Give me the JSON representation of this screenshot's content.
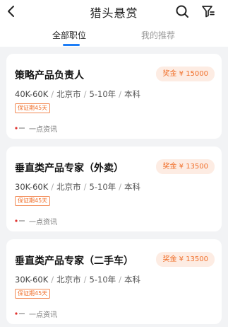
{
  "header": {
    "title": "猎头悬赏",
    "icons": {
      "back": "chevron-left-icon",
      "search": "search-icon",
      "filter": "filter-icon"
    }
  },
  "tabs": [
    {
      "label": "全部职位",
      "active": true
    },
    {
      "label": "我的推荐",
      "active": false
    }
  ],
  "jobs": [
    {
      "title": "策略产品负责人",
      "bonus": "奖金 ¥ 15000",
      "salary": "40K-60K",
      "city": "北京市",
      "experience": "5-10年",
      "education": "本科",
      "tag": "保证期45天",
      "company": "一点资讯"
    },
    {
      "title": "垂直类产品专家（外卖）",
      "bonus": "奖金 ¥ 13500",
      "salary": "30K-60K",
      "city": "北京市",
      "experience": "5-10年",
      "education": "本科",
      "tag": "保证期45天",
      "company": "一点资讯"
    },
    {
      "title": "垂直类产品专家（二手车）",
      "bonus": "奖金 ¥ 13500",
      "salary": "30K-60K",
      "city": "北京市",
      "experience": "5-10年",
      "education": "本科",
      "tag": "保证期45天",
      "company": "一点资讯"
    }
  ],
  "colors": {
    "accent_blue": "#1e7ef6",
    "bonus_orange": "#f06f2a",
    "bonus_bg": "#fdece3",
    "page_bg": "#f2f3f5",
    "logo_red": "#e0322f"
  }
}
